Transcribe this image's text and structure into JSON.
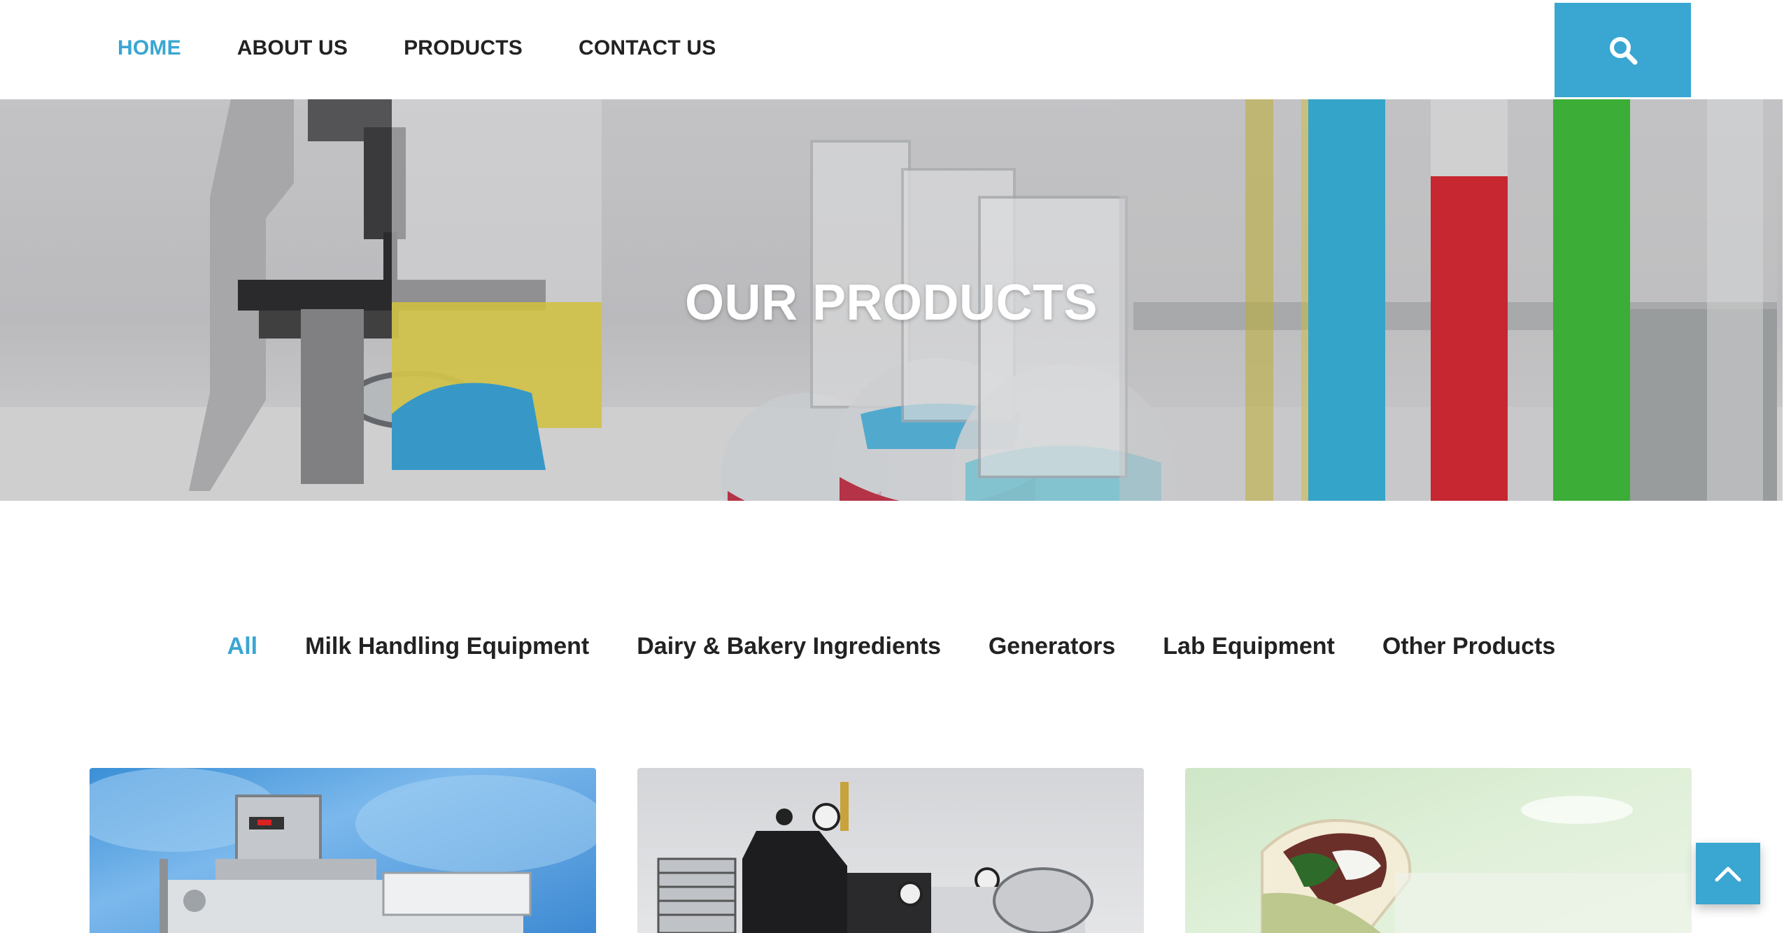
{
  "nav": {
    "items": [
      {
        "label": "HOME",
        "active": true
      },
      {
        "label": "ABOUT US",
        "active": false
      },
      {
        "label": "PRODUCTS",
        "active": false
      },
      {
        "label": "CONTACT US",
        "active": false
      }
    ],
    "search_icon": "search-icon"
  },
  "hero": {
    "title": "OUR PRODUCTS"
  },
  "filters": [
    {
      "label": "All",
      "active": true
    },
    {
      "label": "Milk Handling Equipment",
      "active": false
    },
    {
      "label": "Dairy & Bakery Ingredients",
      "active": false
    },
    {
      "label": "Generators",
      "active": false
    },
    {
      "label": "Lab Equipment",
      "active": false
    },
    {
      "label": "Other Products",
      "active": false
    }
  ],
  "products": [
    {
      "image": "milk-processing-machine"
    },
    {
      "image": "generator-compressor"
    },
    {
      "image": "wrap-sandwich"
    }
  ],
  "back_to_top_icon": "chevron-up-icon",
  "colors": {
    "accent": "#3aa6d2",
    "text": "#222222"
  }
}
